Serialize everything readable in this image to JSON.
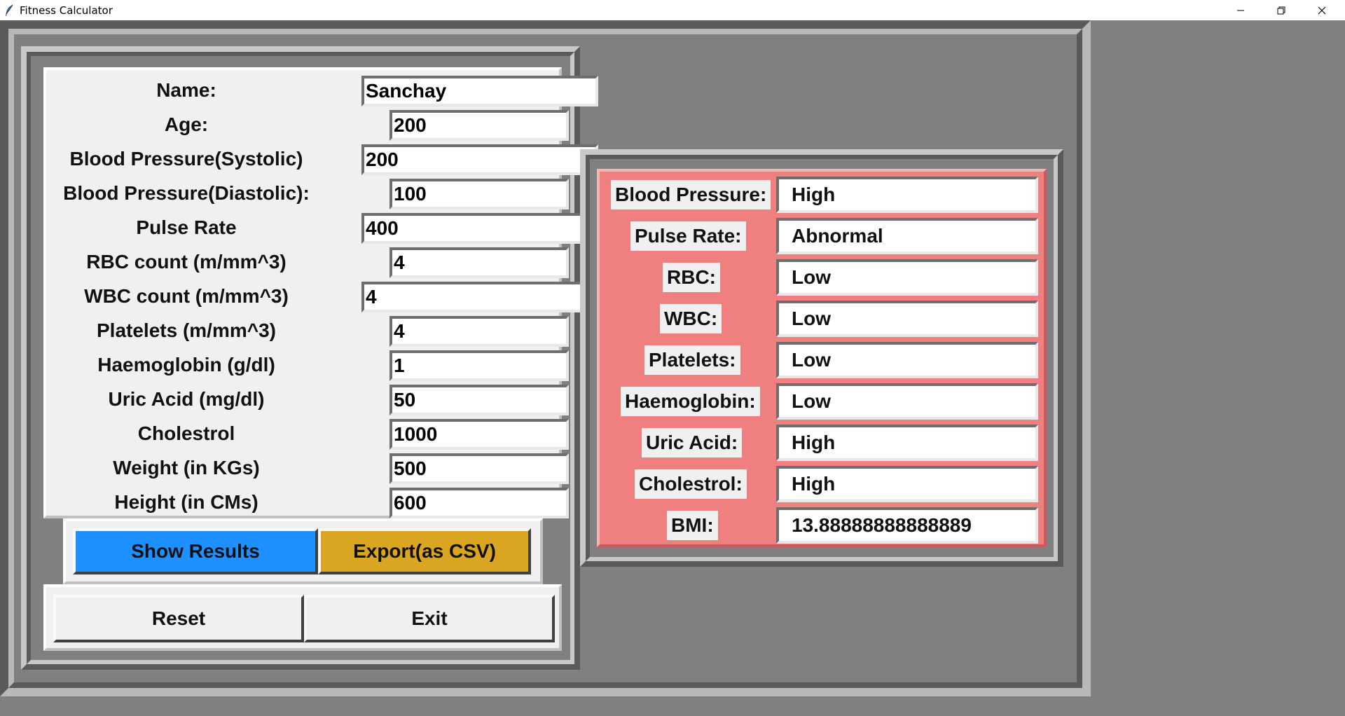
{
  "window": {
    "title": "Fitness Calculator"
  },
  "form": {
    "fields": [
      {
        "label": "Name:",
        "value": "Sanchay"
      },
      {
        "label": "Age:",
        "value": "200"
      },
      {
        "label": "Blood Pressure(Systolic)",
        "value": "200"
      },
      {
        "label": "Blood Pressure(Diastolic):",
        "value": "100"
      },
      {
        "label": "Pulse Rate",
        "value": "400"
      },
      {
        "label": "RBC count (m/mm^3)",
        "value": "4"
      },
      {
        "label": "WBC count (m/mm^3)",
        "value": "4"
      },
      {
        "label": "Platelets (m/mm^3)",
        "value": "4"
      },
      {
        "label": "Haemoglobin (g/dl)",
        "value": "1"
      },
      {
        "label": "Uric Acid (mg/dl)",
        "value": "50"
      },
      {
        "label": "Cholestrol",
        "value": "1000"
      },
      {
        "label": "Weight (in KGs)",
        "value": "500"
      },
      {
        "label": "Height (in CMs)",
        "value": "600"
      }
    ]
  },
  "buttons": {
    "show_results": "Show Results",
    "export": "Export(as CSV)",
    "reset": "Reset",
    "exit": "Exit"
  },
  "results": {
    "rows": [
      {
        "label": "Blood Pressure:",
        "value": "High"
      },
      {
        "label": "Pulse Rate:",
        "value": "Abnormal"
      },
      {
        "label": "RBC:",
        "value": "Low"
      },
      {
        "label": "WBC:",
        "value": "Low"
      },
      {
        "label": "Platelets:",
        "value": "Low"
      },
      {
        "label": "Haemoglobin:",
        "value": "Low"
      },
      {
        "label": "Uric Acid:",
        "value": "High"
      },
      {
        "label": "Cholestrol:",
        "value": "High"
      },
      {
        "label": "BMI:",
        "value": "13.88888888888889"
      }
    ]
  },
  "colors": {
    "show_results_bg": "#1e90ff",
    "export_bg": "#daa520",
    "results_panel_bg": "#f08080",
    "window_bg": "#808080"
  }
}
